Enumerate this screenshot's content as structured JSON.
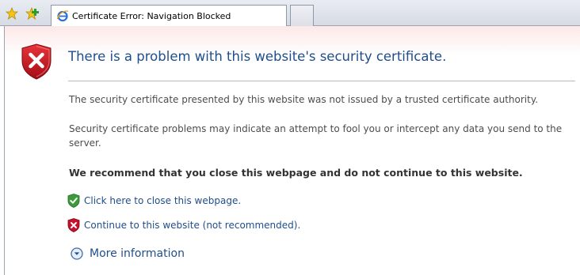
{
  "toolbar": {
    "favorites_icon": "favorites-star-icon",
    "add_favorites_icon": "add-to-favorites-icon"
  },
  "tabs": [
    {
      "title": "Certificate Error: Navigation Blocked",
      "icon": "ie-logo-icon",
      "active": true
    },
    {
      "title": "",
      "icon": "new-tab-icon",
      "active": false
    }
  ],
  "page": {
    "heading": "There is a problem with this website's security certificate.",
    "paragraph1": "The security certificate presented by this website was not issued by a trusted certificate authority.",
    "paragraph2": "Security certificate problems may indicate an attempt to fool you or intercept any data you send to the server.",
    "recommendation": "We recommend that you close this webpage and do not continue to this website.",
    "close_link": "Click here to close this webpage.",
    "continue_link": "Continue to this website (not recommended).",
    "more_info_link": "More information"
  },
  "colors": {
    "heading": "#1f4e8c",
    "link": "#1f4e8c",
    "shield_red": "#c8102e",
    "shield_green": "#3b9b3b"
  }
}
